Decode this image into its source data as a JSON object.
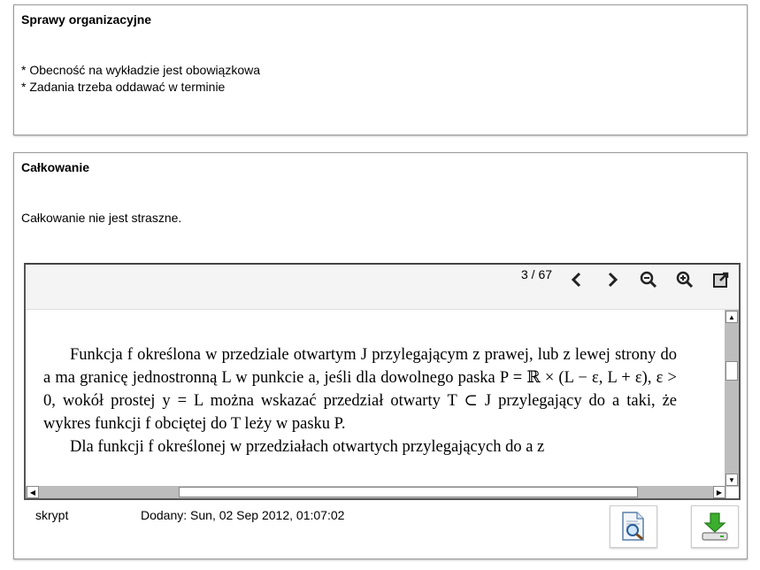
{
  "panel1": {
    "title": "Sprawy organizacyjne",
    "body": "* Obecność na wykładzie jest obowiązkowa\n* Zadania trzeba oddawać w terminie"
  },
  "panel2": {
    "title": "Całkowanie",
    "body": "Całkowanie nie jest straszne.",
    "viewer": {
      "page_indicator": "3 / 67",
      "icons": [
        "prev-page-icon",
        "next-page-icon",
        "zoom-out-icon",
        "zoom-in-icon",
        "open-external-icon"
      ],
      "doc_lines": [
        "Funkcja f określona w przedziale otwartym J przylegającym z prawej, lub z lewej strony do a ma granicę jednostronną L w punkcie a, jeśli dla dowolnego paska P = ℝ × (L − ε, L + ε), ε > 0, wokół prostej y = L można wskazać przedział otwarty T ⊂ J przylegający do a taki, że wykres funkcji f obciętej do T leży w pasku P.",
        "Dla funkcji f określonej w przedziałach otwartych przylegających do a z"
      ]
    },
    "footer": {
      "type_label": "skrypt",
      "added_label": "Dodany: Sun, 02 Sep 2012, 01:07:02"
    }
  }
}
